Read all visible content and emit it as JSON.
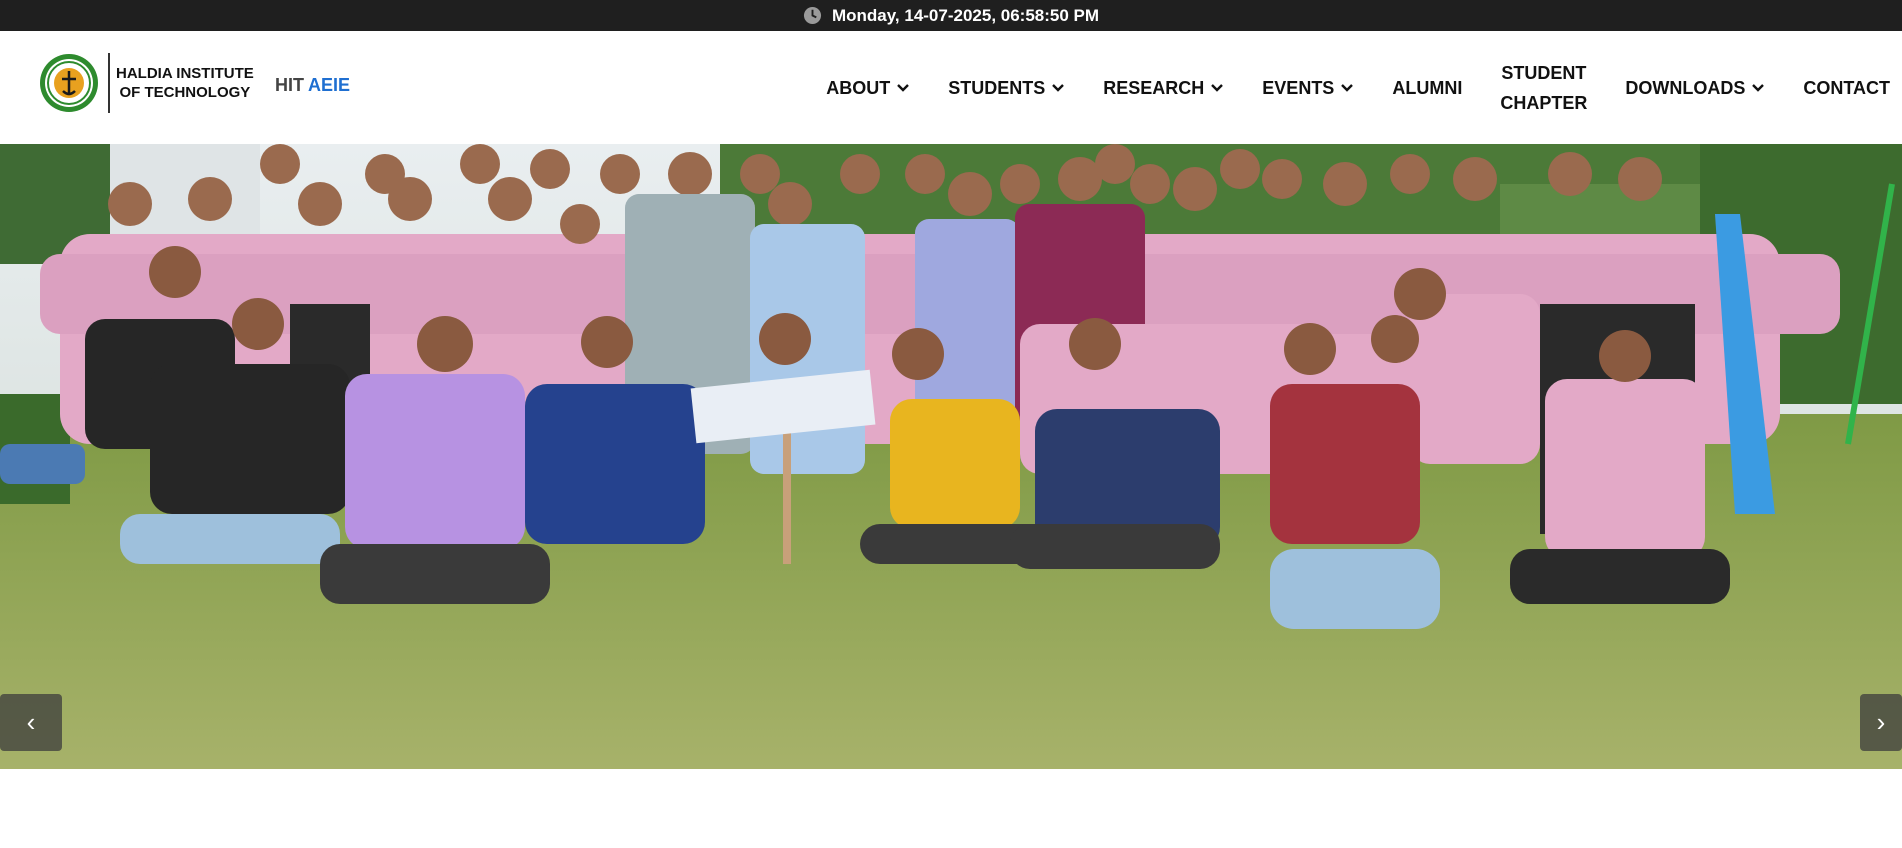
{
  "topbar": {
    "datetime": "Monday, 14-07-2025, 06:58:50 PM",
    "icon": "clock-icon"
  },
  "header": {
    "logo": {
      "line1": "HALDIA INSTITUTE",
      "line2": "OF TECHNOLOGY"
    },
    "dept_prefix": "HIT",
    "dept_name": "AEIE"
  },
  "nav": {
    "items": [
      {
        "label": "ABOUT",
        "dropdown": true
      },
      {
        "label": "STUDENTS",
        "dropdown": true
      },
      {
        "label": "RESEARCH",
        "dropdown": true
      },
      {
        "label": "EVENTS",
        "dropdown": true
      },
      {
        "label": "ALUMNI",
        "dropdown": false
      },
      {
        "label": "STUDENT",
        "label2": "CHAPTER",
        "dropdown": false
      },
      {
        "label": "DOWNLOADS",
        "dropdown": true
      },
      {
        "label": "CONTACT",
        "dropdown": false
      }
    ]
  },
  "carousel": {
    "prev": "‹",
    "next": "›"
  },
  "colors": {
    "topbar_bg": "#1f1f1f",
    "accent": "#1f6fd1",
    "shirt_pink": "#e3a9c7"
  }
}
